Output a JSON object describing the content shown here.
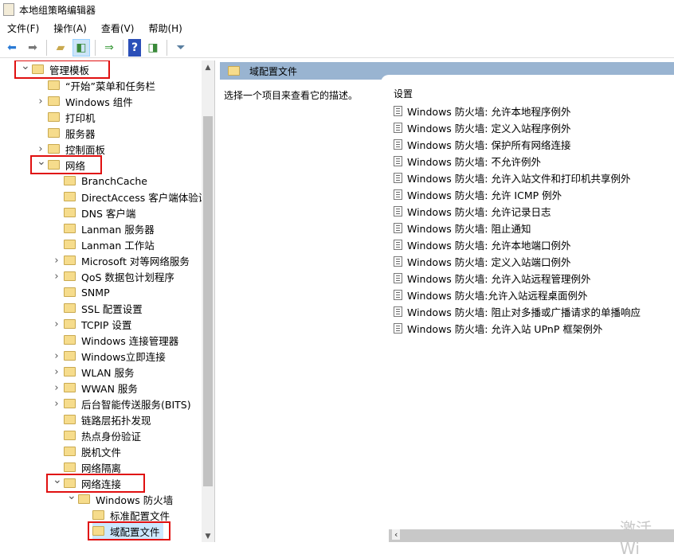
{
  "window": {
    "title": "本地组策略编辑器"
  },
  "menu": [
    "文件(F)",
    "操作(A)",
    "查看(V)",
    "帮助(H)"
  ],
  "tree": [
    {
      "label": "管理模板",
      "level": 0,
      "state": "expanded",
      "highlight": true
    },
    {
      "label": "“开始”菜单和任务栏",
      "level": 1,
      "state": "none"
    },
    {
      "label": "Windows 组件",
      "level": 1,
      "state": "collapsed"
    },
    {
      "label": "打印机",
      "level": 1,
      "state": "none"
    },
    {
      "label": "服务器",
      "level": 1,
      "state": "none"
    },
    {
      "label": "控制面板",
      "level": 1,
      "state": "collapsed"
    },
    {
      "label": "网络",
      "level": 1,
      "state": "expanded",
      "highlight": true
    },
    {
      "label": "BranchCache",
      "level": 2,
      "state": "none"
    },
    {
      "label": "DirectAccess 客户端体验设置",
      "level": 2,
      "state": "none"
    },
    {
      "label": "DNS 客户端",
      "level": 2,
      "state": "none"
    },
    {
      "label": "Lanman 服务器",
      "level": 2,
      "state": "none"
    },
    {
      "label": "Lanman 工作站",
      "level": 2,
      "state": "none"
    },
    {
      "label": "Microsoft 对等网络服务",
      "level": 2,
      "state": "collapsed"
    },
    {
      "label": "QoS 数据包计划程序",
      "level": 2,
      "state": "collapsed"
    },
    {
      "label": "SNMP",
      "level": 2,
      "state": "none"
    },
    {
      "label": "SSL 配置设置",
      "level": 2,
      "state": "none"
    },
    {
      "label": "TCPIP 设置",
      "level": 2,
      "state": "collapsed"
    },
    {
      "label": "Windows 连接管理器",
      "level": 2,
      "state": "none"
    },
    {
      "label": "Windows立即连接",
      "level": 2,
      "state": "collapsed"
    },
    {
      "label": "WLAN 服务",
      "level": 2,
      "state": "collapsed"
    },
    {
      "label": "WWAN 服务",
      "level": 2,
      "state": "collapsed"
    },
    {
      "label": "后台智能传送服务(BITS)",
      "level": 2,
      "state": "collapsed"
    },
    {
      "label": "链路层拓扑发现",
      "level": 2,
      "state": "none"
    },
    {
      "label": "热点身份验证",
      "level": 2,
      "state": "none"
    },
    {
      "label": "脱机文件",
      "level": 2,
      "state": "none"
    },
    {
      "label": "网络隔离",
      "level": 2,
      "state": "none"
    },
    {
      "label": "网络连接",
      "level": 2,
      "state": "expanded",
      "highlight": true
    },
    {
      "label": "Windows 防火墙",
      "level": 3,
      "state": "expanded"
    },
    {
      "label": "标准配置文件",
      "level": 4,
      "state": "none"
    },
    {
      "label": "域配置文件",
      "level": 4,
      "state": "none",
      "highlight": true,
      "selected": true
    }
  ],
  "right": {
    "header": "域配置文件",
    "description": "选择一个项目来查看它的描述。",
    "column": "设置",
    "settings": [
      "Windows 防火墙: 允许本地程序例外",
      "Windows 防火墙: 定义入站程序例外",
      "Windows 防火墙: 保护所有网络连接",
      "Windows 防火墙: 不允许例外",
      "Windows 防火墙: 允许入站文件和打印机共享例外",
      "Windows 防火墙: 允许 ICMP 例外",
      "Windows 防火墙: 允许记录日志",
      "Windows 防火墙: 阻止通知",
      "Windows 防火墙: 允许本地端口例外",
      "Windows 防火墙: 定义入站端口例外",
      "Windows 防火墙: 允许入站远程管理例外",
      "Windows 防火墙:允许入站远程桌面例外",
      "Windows 防火墙: 阻止对多播或广播请求的单播响应",
      "Windows 防火墙: 允许入站 UPnP 框架例外"
    ]
  },
  "watermark": "激活 Wi"
}
